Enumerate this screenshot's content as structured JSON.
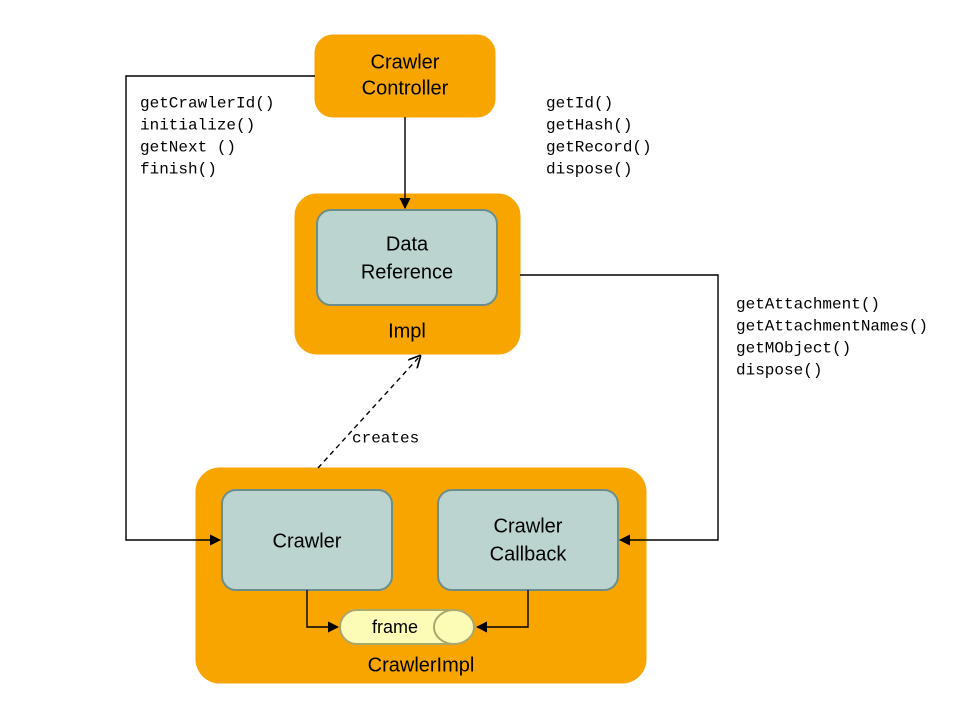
{
  "nodes": {
    "crawler_controller": {
      "line1": "Crawler",
      "line2": "Controller"
    },
    "data_reference": {
      "line1": "Data",
      "line2": "Reference"
    },
    "impl_label": "Impl",
    "crawler": "Crawler",
    "crawler_callback": {
      "line1": "Crawler",
      "line2": "Callback"
    },
    "frame": "frame",
    "crawler_impl_label": "CrawlerImpl"
  },
  "method_groups": {
    "left_group": [
      "getCrawlerId()",
      "initialize()",
      "getNext ()",
      "finish()"
    ],
    "top_right_group": [
      "getId()",
      "getHash()",
      "getRecord()",
      "dispose()"
    ],
    "right_group": [
      "getAttachment()",
      "getAttachmentNames()",
      "getMObject()",
      "dispose()"
    ]
  },
  "edge_labels": {
    "creates": "creates"
  },
  "colors": {
    "orange": "#f9a500",
    "blue_fill": "#bcd4cf",
    "blue_stroke": "#6b8e8a",
    "yellow_fill": "#fdfcb7",
    "yellow_stroke": "#a8a86d"
  }
}
